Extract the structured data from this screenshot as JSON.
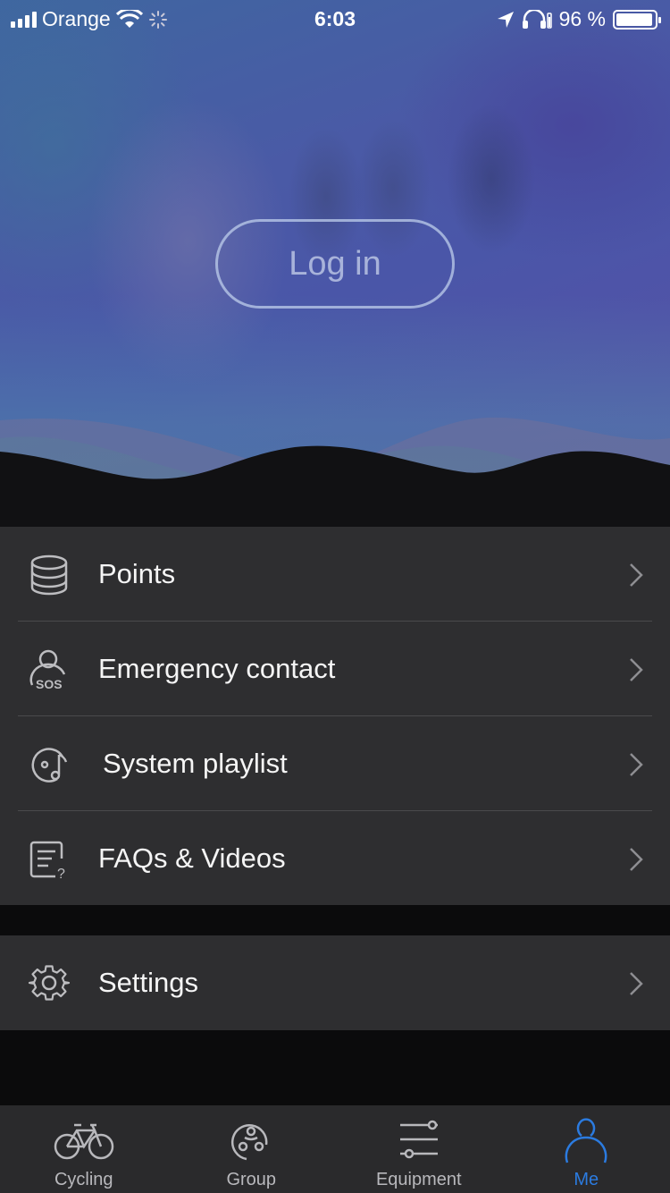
{
  "status_bar": {
    "carrier": "Orange",
    "time": "6:03",
    "battery_percent": "96 %",
    "battery_level": 0.96
  },
  "hero": {
    "login_label": "Log in"
  },
  "menu": {
    "items": [
      {
        "label": "Points",
        "icon": "coins-stack-icon"
      },
      {
        "label": "Emergency contact",
        "icon": "sos-contact-icon"
      },
      {
        "label": "System playlist",
        "icon": "music-disc-icon"
      },
      {
        "label": "FAQs & Videos",
        "icon": "faq-document-icon"
      }
    ],
    "settings": {
      "label": "Settings",
      "icon": "gear-icon"
    }
  },
  "tab_bar": {
    "tabs": [
      {
        "label": "Cycling",
        "icon": "bicycle-icon",
        "active": false
      },
      {
        "label": "Group",
        "icon": "group-icon",
        "active": false
      },
      {
        "label": "Equipment",
        "icon": "sliders-icon",
        "active": false
      },
      {
        "label": "Me",
        "icon": "person-icon",
        "active": true
      }
    ]
  },
  "colors": {
    "accent": "#2b7be0",
    "menu_background": "#2e2e30",
    "page_background": "#0b0b0c"
  }
}
